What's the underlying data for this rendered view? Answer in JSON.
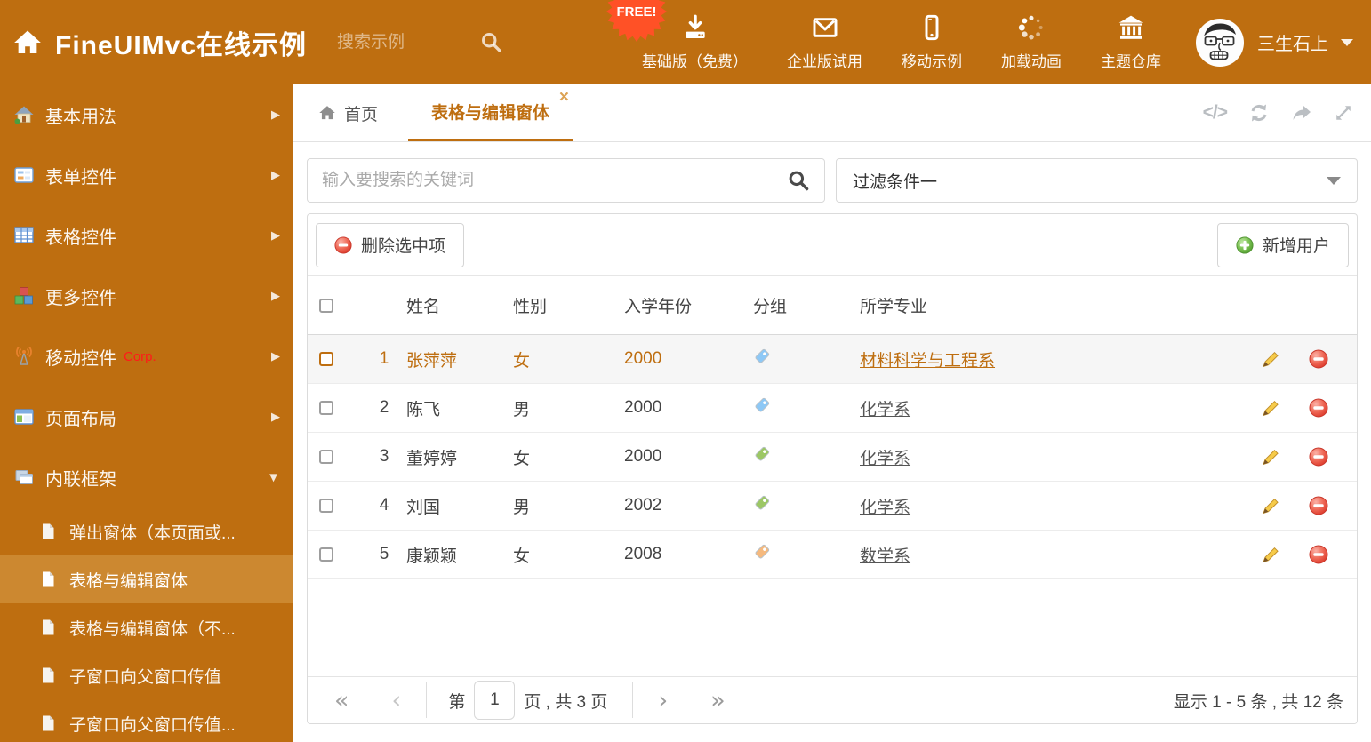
{
  "header": {
    "brand": "FineUIMvc在线示例",
    "search_placeholder": "搜索示例",
    "free_badge": "FREE!",
    "nav": [
      {
        "label": "基础版（免费）",
        "icon": "download-icon"
      },
      {
        "label": "企业版试用",
        "icon": "mail-icon"
      },
      {
        "label": "移动示例",
        "icon": "mobile-icon"
      },
      {
        "label": "加载动画",
        "icon": "spinner-icon"
      },
      {
        "label": "主题仓库",
        "icon": "bank-icon"
      }
    ],
    "user_name": "三生石上"
  },
  "sidebar": {
    "items": [
      {
        "label": "基本用法",
        "icon": "home-icon"
      },
      {
        "label": "表单控件",
        "icon": "form-icon"
      },
      {
        "label": "表格控件",
        "icon": "table-icon"
      },
      {
        "label": "更多控件",
        "icon": "cubes-icon"
      },
      {
        "label": "移动控件",
        "icon": "antenna-icon",
        "badge": "Corp."
      },
      {
        "label": "页面布局",
        "icon": "layout-icon"
      },
      {
        "label": "内联框架",
        "icon": "frames-icon"
      }
    ],
    "subitems": [
      {
        "label": "弹出窗体（本页面或..."
      },
      {
        "label": "表格与编辑窗体"
      },
      {
        "label": "表格与编辑窗体（不..."
      },
      {
        "label": "子窗口向父窗口传值"
      },
      {
        "label": "子窗口向父窗口传值..."
      }
    ]
  },
  "tabs": {
    "home_label": "首页",
    "active_label": "表格与编辑窗体"
  },
  "filter": {
    "search_placeholder": "输入要搜索的关键词",
    "dropdown_value": "过滤条件一"
  },
  "toolbar": {
    "delete_label": "删除选中项",
    "add_label": "新增用户"
  },
  "table": {
    "headers": [
      "姓名",
      "性别",
      "入学年份",
      "分组",
      "所学专业"
    ],
    "rows": [
      {
        "num": "1",
        "name": "张萍萍",
        "gender": "女",
        "year": "2000",
        "tag_color": "#8DC8F6",
        "major": "材料科学与工程系"
      },
      {
        "num": "2",
        "name": "陈飞",
        "gender": "男",
        "year": "2000",
        "tag_color": "#8DC8F6",
        "major": "化学系"
      },
      {
        "num": "3",
        "name": "董婷婷",
        "gender": "女",
        "year": "2000",
        "tag_color": "#9CC765",
        "major": "化学系"
      },
      {
        "num": "4",
        "name": "刘国",
        "gender": "男",
        "year": "2002",
        "tag_color": "#9CC765",
        "major": "化学系"
      },
      {
        "num": "5",
        "name": "康颖颖",
        "gender": "女",
        "year": "2008",
        "tag_color": "#F5B97E",
        "major": "数学系"
      }
    ]
  },
  "pagination": {
    "prefix": "第",
    "page": "1",
    "suffix": "页 , 共 3 页",
    "summary": "显示 1 - 5 条 , 共 12 条"
  },
  "icons": {
    "first": "«",
    "prev": "‹",
    "next": "›",
    "last": "»",
    "code": "</>",
    "close": "×",
    "collapsed_arrow": "▶",
    "expanded_arrow": "▼"
  },
  "colors": {
    "theme_orange": "#BE6E10",
    "selected_orange": "#CC8830",
    "free_badge_red": "#FF5126",
    "highlight_text": "#BE6E10",
    "tag_blue": "#8DC8F6",
    "tag_green": "#9CC765",
    "tag_orange": "#F5B97E"
  }
}
